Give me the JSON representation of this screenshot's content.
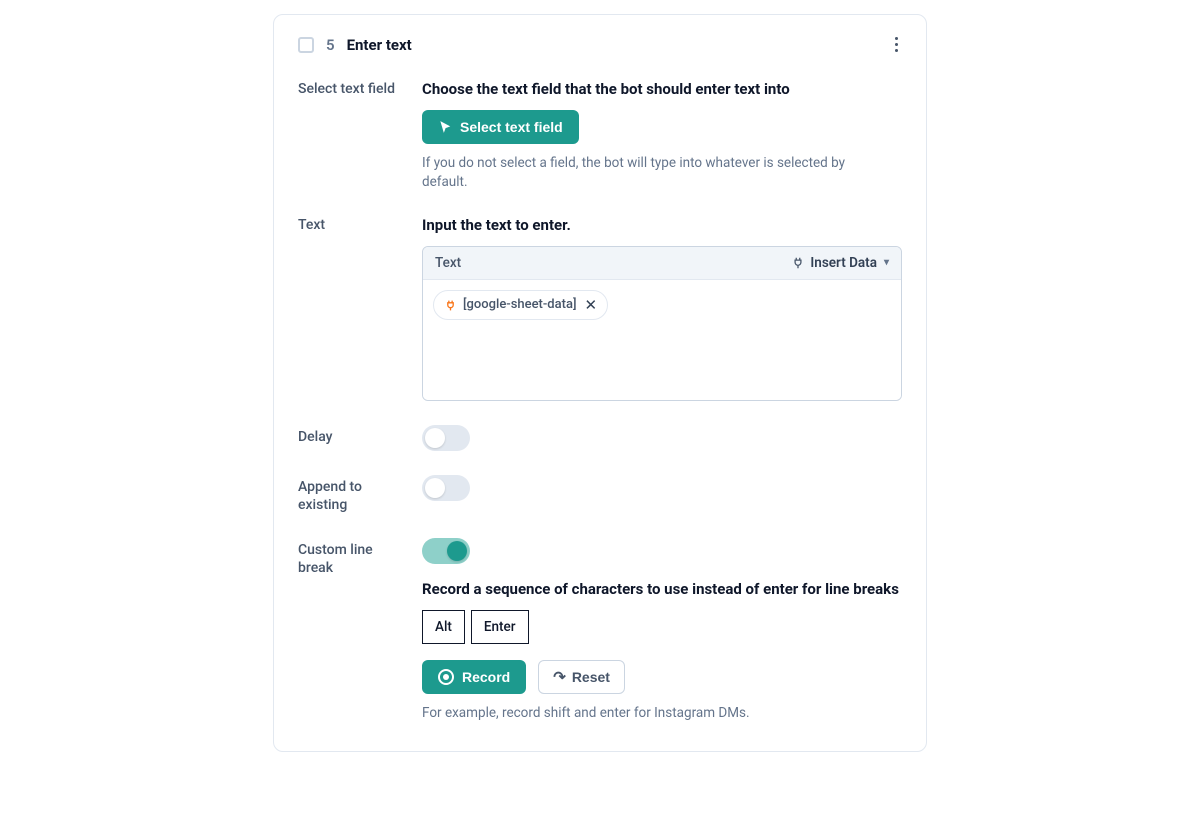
{
  "step": {
    "number": "5",
    "title": "Enter text"
  },
  "selectField": {
    "label": "Select text field",
    "heading": "Choose the text field that the bot should enter text into",
    "button": "Select text field",
    "helper": "If you do not select a field, the bot will type into whatever is selected by default."
  },
  "textInput": {
    "label": "Text",
    "heading": "Input the text to enter.",
    "boxLabel": "Text",
    "insertData": "Insert Data",
    "chipValue": "[google-sheet-data]"
  },
  "delay": {
    "label": "Delay",
    "on": false
  },
  "append": {
    "label": "Append to existing",
    "on": false
  },
  "lineBreak": {
    "label": "Custom line break",
    "on": true,
    "heading": "Record a sequence of characters to use instead of enter for line breaks",
    "keys": [
      "Alt",
      "Enter"
    ],
    "recordBtn": "Record",
    "resetBtn": "Reset",
    "helper": "For example, record shift and enter for Instagram DMs."
  }
}
